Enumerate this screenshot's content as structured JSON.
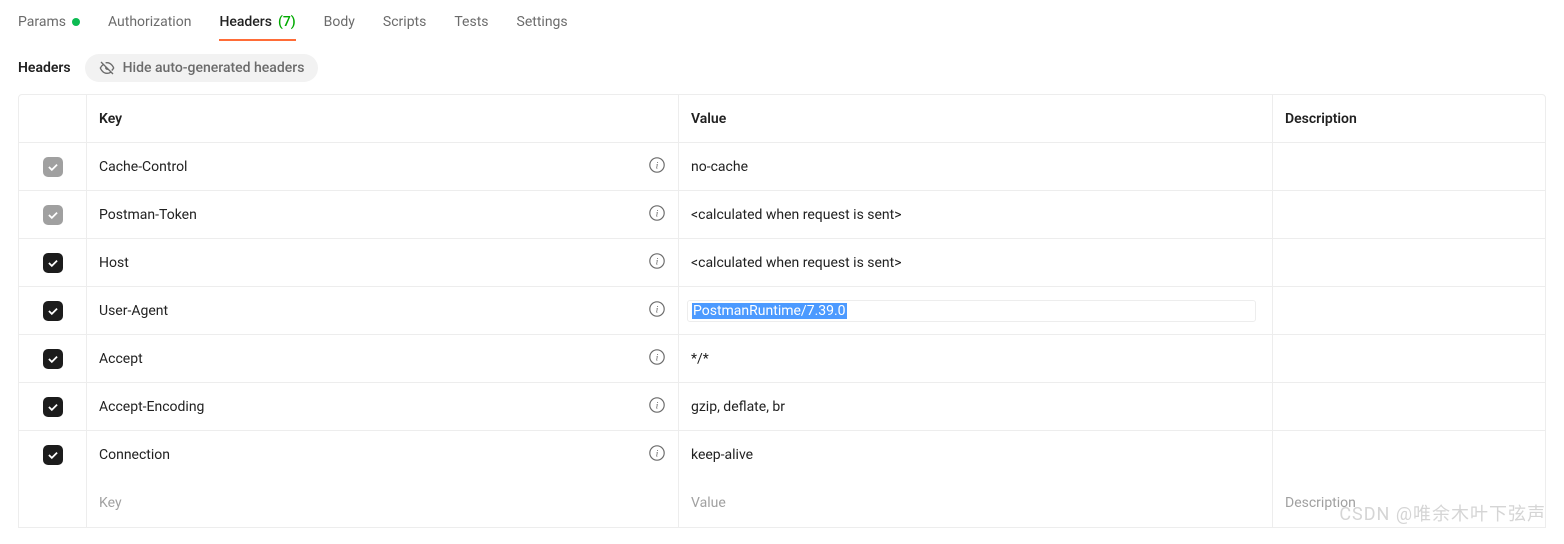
{
  "tabs": [
    {
      "label": "Params",
      "hasDot": true
    },
    {
      "label": "Authorization"
    },
    {
      "label": "Headers",
      "count": "(7)",
      "active": true
    },
    {
      "label": "Body"
    },
    {
      "label": "Scripts"
    },
    {
      "label": "Tests"
    },
    {
      "label": "Settings"
    }
  ],
  "section": {
    "title": "Headers",
    "hideButton": "Hide auto-generated headers"
  },
  "columns": {
    "key": "Key",
    "value": "Value",
    "description": "Description"
  },
  "rows": [
    {
      "checked": true,
      "checkStyle": "gray",
      "key": "Cache-Control",
      "value": "no-cache",
      "info": true
    },
    {
      "checked": true,
      "checkStyle": "gray",
      "key": "Postman-Token",
      "value": "<calculated when request is sent>",
      "info": true
    },
    {
      "checked": true,
      "checkStyle": "dark",
      "key": "Host",
      "value": "<calculated when request is sent>",
      "info": true
    },
    {
      "checked": true,
      "checkStyle": "dark",
      "key": "User-Agent",
      "value": "PostmanRuntime/7.39.0",
      "info": true,
      "selected": true
    },
    {
      "checked": true,
      "checkStyle": "dark",
      "key": "Accept",
      "value": "*/*",
      "info": true
    },
    {
      "checked": true,
      "checkStyle": "dark",
      "key": "Accept-Encoding",
      "value": "gzip, deflate, br",
      "info": true
    },
    {
      "checked": true,
      "checkStyle": "dark",
      "key": "Connection",
      "value": "keep-alive",
      "info": true
    }
  ],
  "placeholders": {
    "key": "Key",
    "value": "Value",
    "description": "Description"
  },
  "watermark": "CSDN @唯余木叶下弦声"
}
